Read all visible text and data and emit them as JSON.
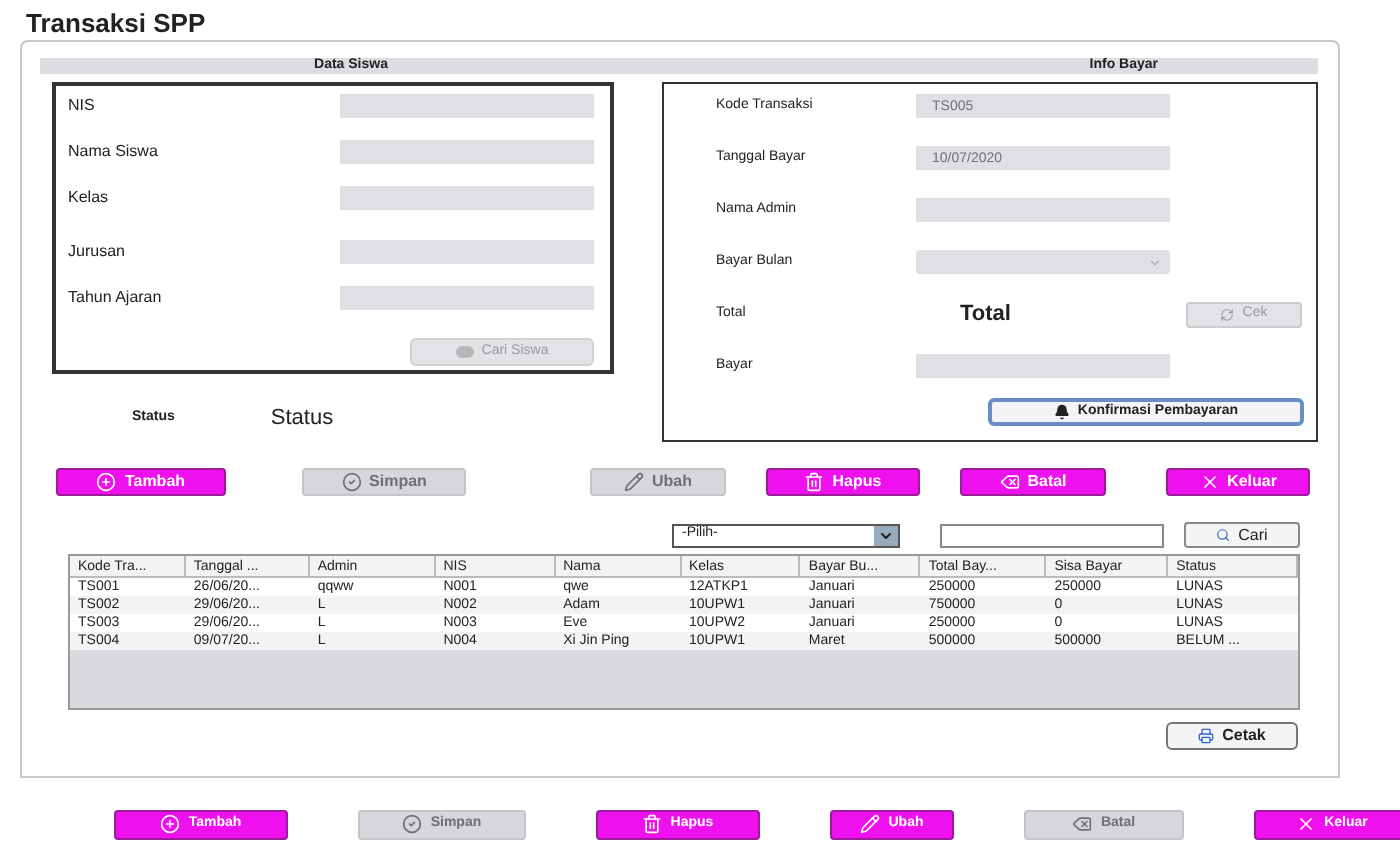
{
  "title": "Transaksi SPP",
  "data_siswa": {
    "heading": "Data Siswa",
    "fields": [
      {
        "label": "NIS",
        "kind": "text"
      },
      {
        "label": "Nama Siswa",
        "kind": "text"
      },
      {
        "label": "Kelas",
        "kind": "text"
      },
      {
        "label": "Jurusan",
        "kind": "text"
      },
      {
        "label": "Tahun Ajaran",
        "kind": "text"
      }
    ],
    "search_button": {
      "label": "Cari Siswa",
      "disabled": true
    }
  },
  "info_bayar": {
    "heading": "Info Bayar",
    "fields": [
      {
        "label": "Kode Transaksi",
        "kind": "text",
        "value": "TS005"
      },
      {
        "label": "Tanggal Bayar",
        "kind": "text",
        "value": "10/07/2020"
      },
      {
        "label": "Nama Admin",
        "kind": "text"
      },
      {
        "label": "Bayar Bulan",
        "kind": "select"
      },
      {
        "label": "Total",
        "kind": "total",
        "value": "Total",
        "button": {
          "label": "Cek",
          "disabled": true
        }
      },
      {
        "label": "Bayar",
        "kind": "text"
      }
    ],
    "confirm_button": {
      "label": "Konfirmasi Pembayaran",
      "disabled": false
    }
  },
  "status": {
    "label": "Status",
    "value": "Status"
  },
  "actions": [
    {
      "label": "Tambah",
      "kind": "plus",
      "disabled": false
    },
    {
      "label": "Simpan",
      "kind": "check",
      "disabled": true
    },
    {
      "label": "Ubah",
      "kind": "pencil",
      "disabled": true
    },
    {
      "label": "Hapus",
      "kind": "trash",
      "disabled": false
    },
    {
      "label": "Batal",
      "kind": "erase",
      "disabled": false
    },
    {
      "label": "Keluar",
      "kind": "x",
      "disabled": false
    }
  ],
  "filter": {
    "select_value": "-Pilih-",
    "search_button": "Cari"
  },
  "table": {
    "columns": [
      "Kode Tra...",
      "Tanggal ...",
      "Admin",
      "NIS",
      "Nama",
      "Kelas",
      "Bayar Bu...",
      "Total Bay...",
      "Sisa Bayar",
      "Status"
    ],
    "rows": [
      [
        "TS001",
        "26/06/20...",
        "qqww",
        "N001",
        "qwe",
        "12ATKP1",
        "Januari",
        "250000",
        "250000",
        "LUNAS"
      ],
      [
        "TS002",
        "29/06/20...",
        "L",
        "N002",
        "Adam",
        "10UPW1",
        "Januari",
        "750000",
        "0",
        "LUNAS"
      ],
      [
        "TS003",
        "29/06/20...",
        "L",
        "N003",
        "Eve",
        "10UPW2",
        "Januari",
        "250000",
        "0",
        "LUNAS"
      ],
      [
        "TS004",
        "09/07/20...",
        "L",
        "N004",
        "Xi Jin Ping",
        "10UPW1",
        "Maret",
        "500000",
        "500000",
        "BELUM ..."
      ]
    ]
  },
  "print_button": "Cetak",
  "bottom_actions": [
    {
      "label": "Tambah",
      "kind": "plus",
      "disabled": false
    },
    {
      "label": "Simpan",
      "kind": "check",
      "disabled": true
    },
    {
      "label": "Hapus",
      "kind": "trash",
      "disabled": false
    },
    {
      "label": "Ubah",
      "kind": "pencil",
      "disabled": false
    },
    {
      "label": "Batal",
      "kind": "erase",
      "disabled": true
    },
    {
      "label": "Keluar",
      "kind": "x",
      "disabled": false
    }
  ]
}
